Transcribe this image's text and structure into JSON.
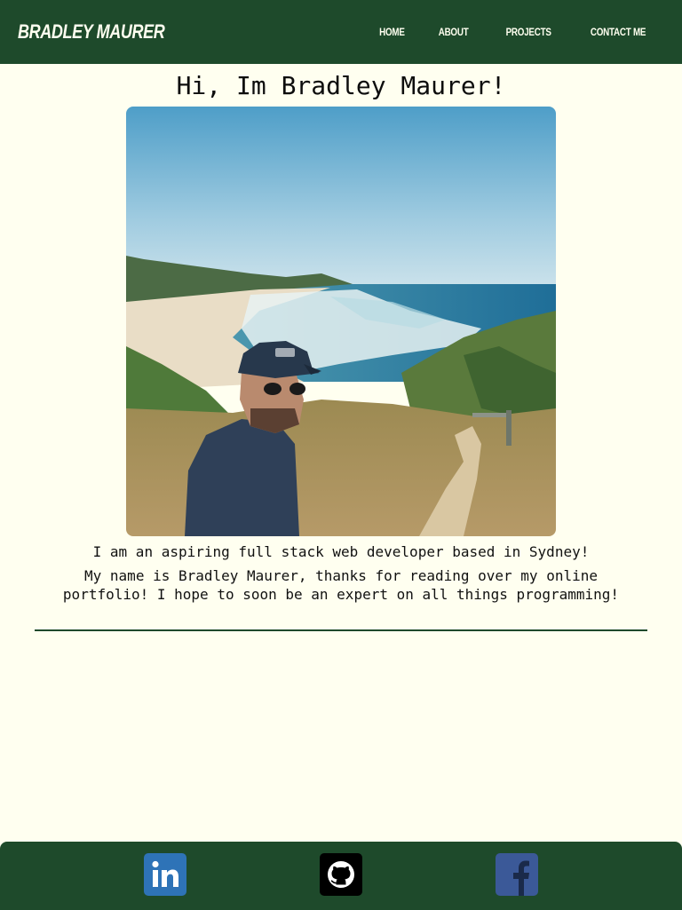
{
  "header": {
    "brand": "BRADLEY MAURER",
    "nav": [
      {
        "label": "HOME"
      },
      {
        "label": "ABOUT"
      },
      {
        "label": "PROJECTS"
      },
      {
        "label": "CONTACT ME"
      }
    ]
  },
  "main": {
    "title": "Hi, Im Bradley Maurer!",
    "tagline": "I am an aspiring full stack web developer based in Sydney!",
    "intro": "My name is Bradley Maurer, thanks for reading over my online portfolio! I hope to soon be an expert on all things programming!"
  },
  "footer": {
    "social": [
      {
        "name": "linkedin",
        "icon": "linkedin-icon"
      },
      {
        "name": "github",
        "icon": "github-icon"
      },
      {
        "name": "facebook",
        "icon": "facebook-icon"
      }
    ]
  },
  "colors": {
    "brand_green": "#1e4a2b",
    "background": "#fffff0",
    "linkedin": "#2e73b7",
    "github": "#000000",
    "facebook": "#3b5998"
  }
}
